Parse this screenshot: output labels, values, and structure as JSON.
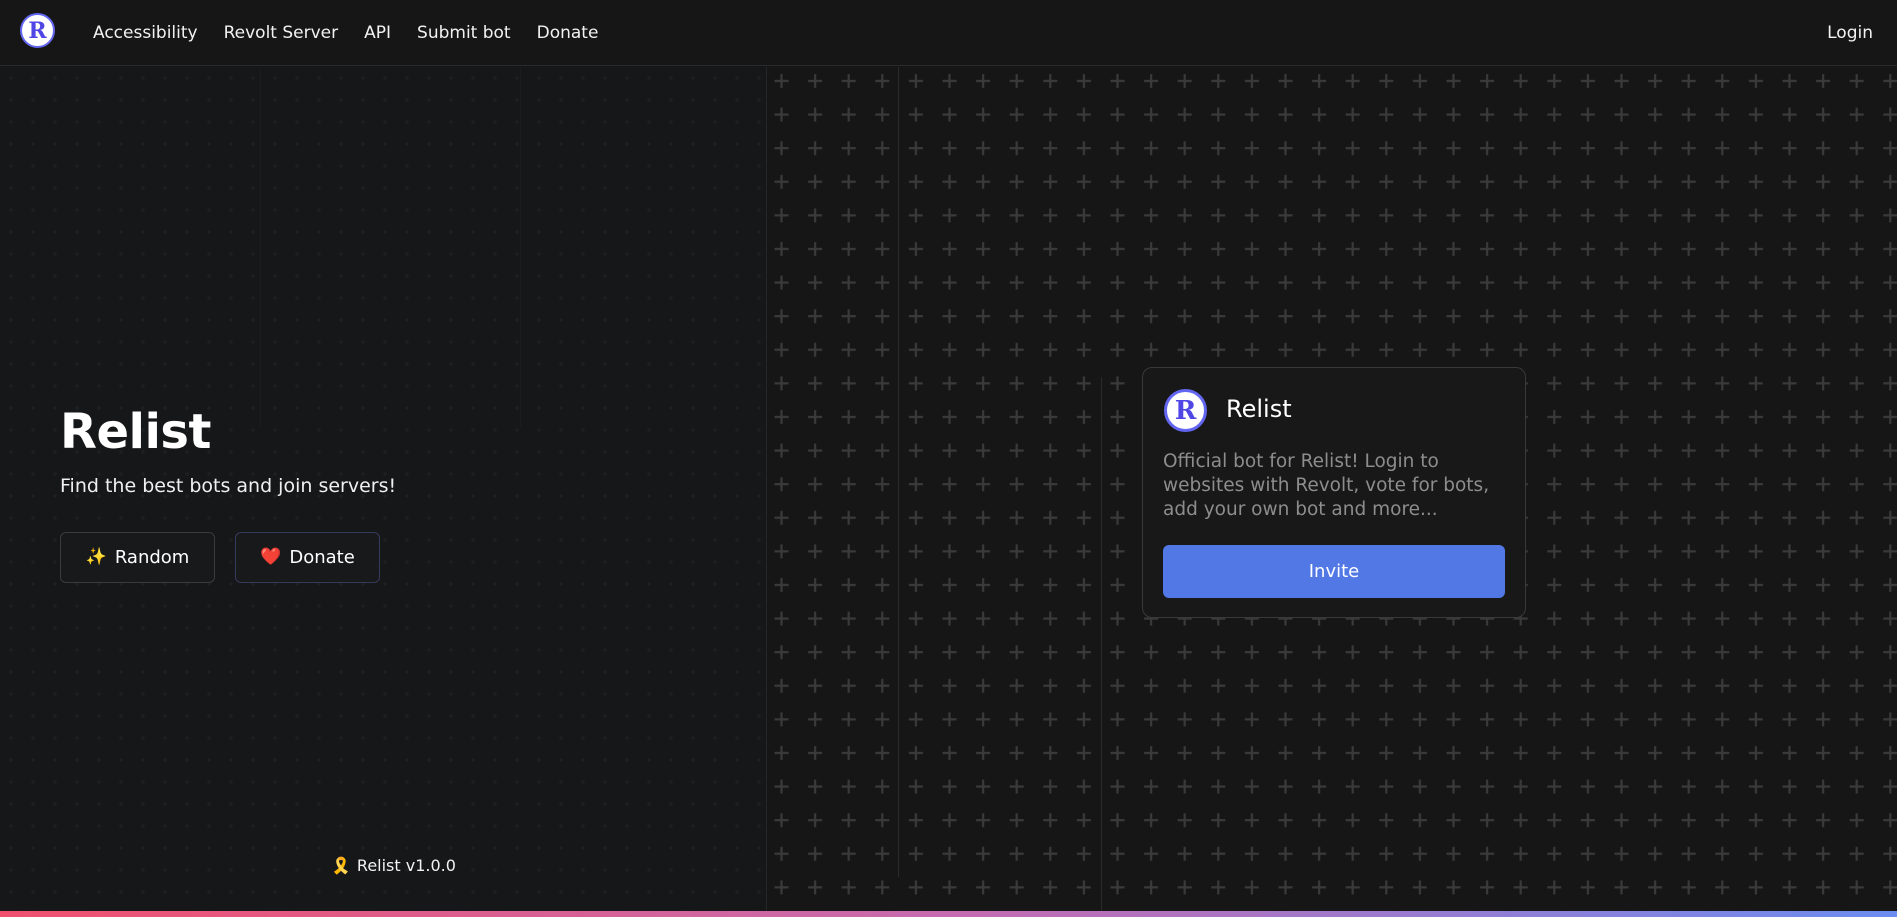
{
  "nav": {
    "logo_letter": "R",
    "links": [
      "Accessibility",
      "Revolt Server",
      "API",
      "Submit bot",
      "Donate"
    ],
    "login_label": "Login"
  },
  "hero": {
    "title": "Relist",
    "subtitle": "Find the best bots and join servers!",
    "random_emoji": "✨",
    "random_label": "Random",
    "donate_emoji": "❤️",
    "donate_label": "Donate"
  },
  "footer": {
    "version_icon": "🎗️",
    "version_label": "Relist v1.0.0"
  },
  "bot_card": {
    "avatar_letter": "R",
    "name": "Relist",
    "description": "Official bot for Relist! Login to websites with Revolt, vote for bots, add your own bot and more...",
    "invite_label": "Invite"
  },
  "colors": {
    "accent": "#5178e4",
    "brand": "#6366f1",
    "gradient_start": "#f0506e",
    "gradient_end": "#6b8cf0"
  }
}
